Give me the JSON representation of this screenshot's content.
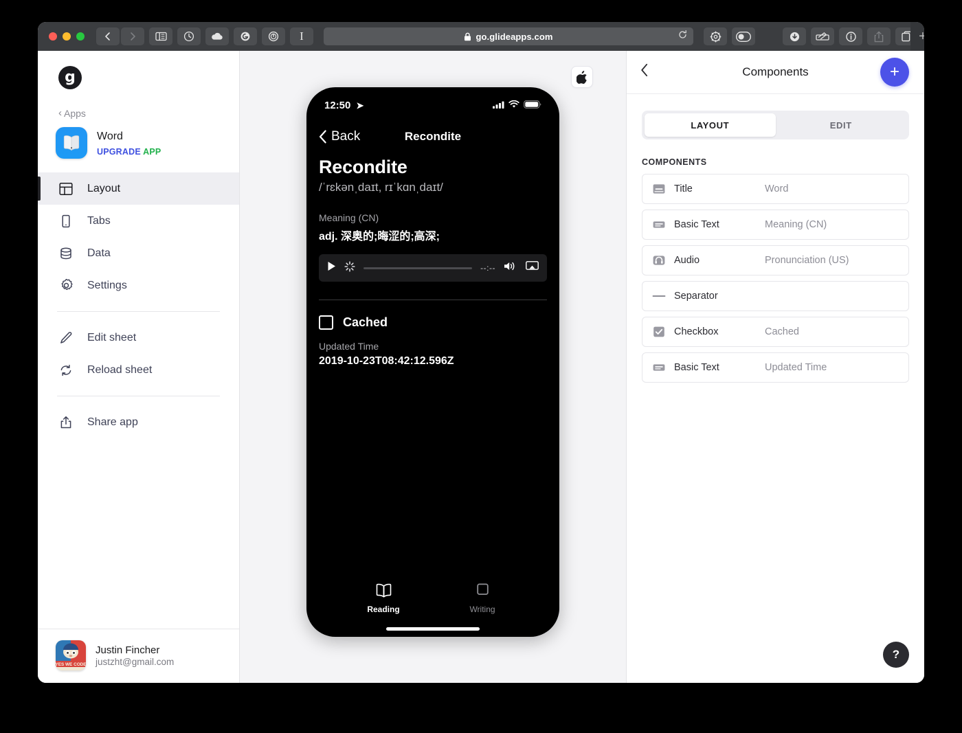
{
  "browser": {
    "url": "go.glideapps.com",
    "lock_icon": "lock-icon",
    "reload_icon": "reload-icon",
    "new_tab_label": "+",
    "toolbar_left_icons": [
      "back-icon",
      "forward-icon",
      "sidebar-icon",
      "history-icon",
      "icloud-icon",
      "grammarly-icon",
      "1password-icon",
      "instapaper-icon"
    ],
    "toolbar_right_icons": [
      "gear-icon",
      "dark-mode-icon",
      "download-icon",
      "markup-icon",
      "info-icon",
      "share-icon",
      "tabs-icon"
    ]
  },
  "sidebar": {
    "logo_letter": "g",
    "apps_back": "Apps",
    "app": {
      "name": "Word",
      "upgrade_prefix": "UPGRADE",
      "upgrade_suffix": "APP",
      "icon": "book-app-icon"
    },
    "nav_primary": [
      {
        "label": "Layout",
        "icon": "layout-icon",
        "active": true
      },
      {
        "label": "Tabs",
        "icon": "phone-icon",
        "active": false
      },
      {
        "label": "Data",
        "icon": "database-icon",
        "active": false
      },
      {
        "label": "Settings",
        "icon": "gear-icon",
        "active": false
      }
    ],
    "nav_sheet": [
      {
        "label": "Edit sheet",
        "icon": "pencil-icon"
      },
      {
        "label": "Reload sheet",
        "icon": "refresh-icon"
      }
    ],
    "nav_share": [
      {
        "label": "Share app",
        "icon": "share-icon"
      }
    ],
    "user": {
      "name": "Justin Fincher",
      "email": "justzht@gmail.com",
      "avatar": "yes-we-code-avatar"
    }
  },
  "preview": {
    "platform_button_icon": "apple-icon",
    "status_bar": {
      "time": "12:50",
      "location_icon": "location-arrow-icon",
      "signal_icon": "cellular-signal-icon",
      "wifi_icon": "wifi-icon",
      "battery_icon": "battery-icon"
    },
    "nav": {
      "back_label": "Back",
      "title": "Recondite"
    },
    "word": {
      "title": "Recondite",
      "ipa": "/ˈrɛkənˌdaɪt, rɪˈkɑnˌdaɪt/",
      "meaning_label": "Meaning (CN)",
      "meaning_value": "adj. 深奥的;晦涩的;高深;"
    },
    "audio": {
      "play_icon": "play-icon",
      "spinner_icon": "loading-spinner-icon",
      "time": "--:--",
      "volume_icon": "volume-icon",
      "airplay_icon": "airplay-icon"
    },
    "checkbox": {
      "label": "Cached",
      "checked": false
    },
    "updated": {
      "label": "Updated Time",
      "value": "2019-10-23T08:42:12.596Z"
    },
    "tabs": [
      {
        "label": "Reading",
        "icon": "book-icon",
        "active": true
      },
      {
        "label": "Writing",
        "icon": "square-icon",
        "active": false
      }
    ]
  },
  "right_panel": {
    "back_icon": "chevron-left-icon",
    "title": "Components",
    "add_button_label": "+",
    "segments": [
      {
        "label": "LAYOUT",
        "active": true
      },
      {
        "label": "EDIT",
        "active": false
      }
    ],
    "section_title": "COMPONENTS",
    "components": [
      {
        "name": "Title",
        "value": "Word",
        "icon": "title-component-icon"
      },
      {
        "name": "Basic Text",
        "value": "Meaning (CN)",
        "icon": "text-component-icon"
      },
      {
        "name": "Audio",
        "value": "Pronunciation (US)",
        "icon": "headphones-component-icon"
      },
      {
        "name": "Separator",
        "value": "",
        "icon": "separator-component-icon"
      },
      {
        "name": "Checkbox",
        "value": "Cached",
        "icon": "checkbox-component-icon"
      },
      {
        "name": "Basic Text",
        "value": "Updated Time",
        "icon": "text-component-icon"
      }
    ],
    "help_label": "?"
  },
  "colors": {
    "accent": "#4c52e8",
    "upgrade_blue": "#3f51e0",
    "upgrade_green": "#22b14c",
    "toolbar": "#3b3d40",
    "panel_bg": "#f4f4f6"
  }
}
